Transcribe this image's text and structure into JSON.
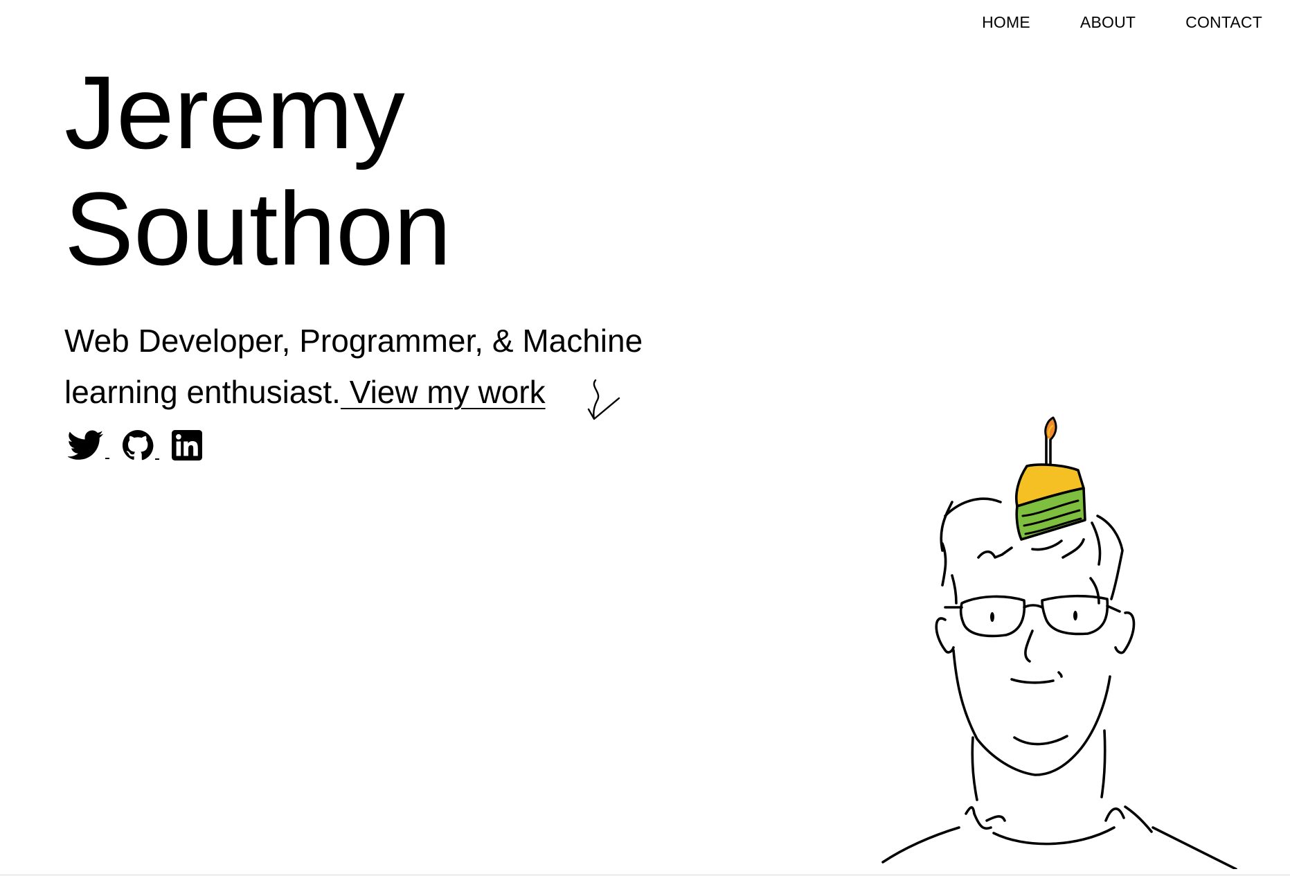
{
  "nav": {
    "items": [
      {
        "label": "HOME"
      },
      {
        "label": "ABOUT"
      },
      {
        "label": "CONTACT"
      }
    ]
  },
  "hero": {
    "first_name": "Jeremy",
    "last_name": "Southon",
    "tagline_text": "Web Developer, Programmer, & Machine learning enthusiast.",
    "cta_link": " View my work"
  },
  "socials": [
    {
      "icon": "twitter-icon"
    },
    {
      "icon": "github-icon"
    },
    {
      "icon": "linkedin-icon"
    }
  ],
  "colors": {
    "text": "#000000",
    "background": "#ffffff",
    "cake_frosting": "#f5c024",
    "cake_sponge": "#7fbf3f",
    "candle_flame": "#f08a2a"
  }
}
